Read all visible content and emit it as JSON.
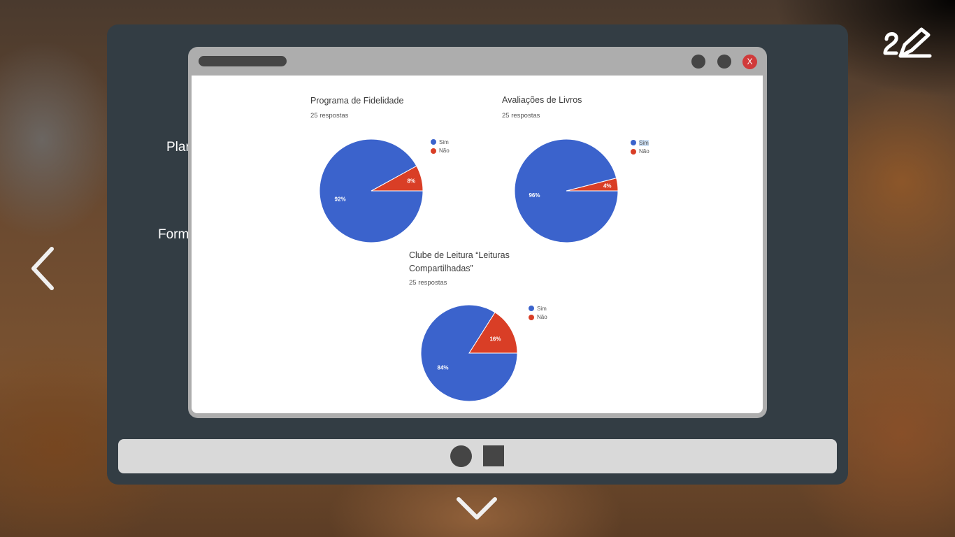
{
  "background": {
    "partial_texts": [
      "Plan",
      "Form"
    ]
  },
  "window": {
    "close_label": "X"
  },
  "charts": [
    {
      "title": "Programa de Fidelidade",
      "subtitle": "25 respostas",
      "legend": [
        "Sim",
        "Não"
      ]
    },
    {
      "title": "Avaliações de Livros",
      "subtitle": "25 respostas",
      "legend": [
        "Sim",
        "Não"
      ]
    },
    {
      "title_line1": "Clube de Leitura “Leituras",
      "title_line2": "Compartilhadas”",
      "subtitle": "25 respostas",
      "legend": [
        "Sim",
        "Não"
      ]
    }
  ],
  "colors": {
    "sim": "#3b63cc",
    "nao": "#d93e26",
    "frame": "#333d44"
  },
  "icons": [
    "chevron-left-icon",
    "chevron-down-icon",
    "edit-pen-icon"
  ],
  "chart_data": [
    {
      "type": "pie",
      "title": "Programa de Fidelidade",
      "categories": [
        "Sim",
        "Não"
      ],
      "values": [
        92,
        8
      ],
      "labels": [
        "92%",
        "8%"
      ]
    },
    {
      "type": "pie",
      "title": "Avaliações de Livros",
      "categories": [
        "Sim",
        "Não"
      ],
      "values": [
        96,
        4
      ],
      "labels": [
        "96%",
        "4%"
      ]
    },
    {
      "type": "pie",
      "title": "Clube de Leitura “Leituras Compartilhadas”",
      "categories": [
        "Sim",
        "Não"
      ],
      "values": [
        84,
        16
      ],
      "labels": [
        "84%",
        "16%"
      ]
    }
  ]
}
